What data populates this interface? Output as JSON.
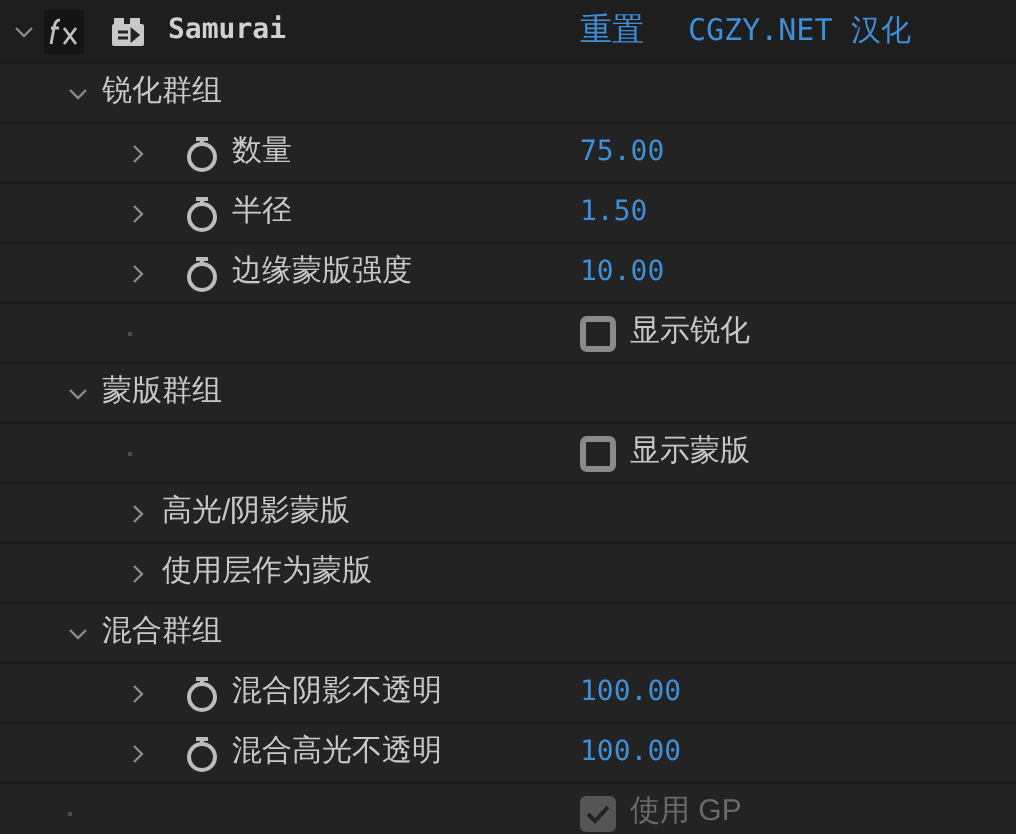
{
  "effect": {
    "name": "Samurai",
    "expanded": true,
    "reset": "重置",
    "credit": "CGZY.NET 汉化",
    "children": [
      {
        "kind": "group",
        "label": "锐化群组",
        "expanded": true,
        "children": [
          {
            "kind": "property",
            "label": "数量",
            "value": "75.00",
            "expanded": false
          },
          {
            "kind": "property",
            "label": "半径",
            "value": "1.50",
            "expanded": false
          },
          {
            "kind": "property",
            "label": "边缘蒙版强度",
            "value": "10.00",
            "expanded": false
          },
          {
            "kind": "checkbox",
            "label": "显示锐化",
            "checked": false,
            "disabled": false
          }
        ]
      },
      {
        "kind": "group",
        "label": "蒙版群组",
        "expanded": true,
        "children": [
          {
            "kind": "checkbox",
            "label": "显示蒙版",
            "checked": false,
            "disabled": false
          },
          {
            "kind": "group",
            "label": "高光/阴影蒙版",
            "expanded": false
          },
          {
            "kind": "group",
            "label": "使用层作为蒙版",
            "expanded": false
          }
        ]
      },
      {
        "kind": "group",
        "label": "混合群组",
        "expanded": true,
        "children": [
          {
            "kind": "property",
            "label": "混合阴影不透明",
            "value": "100.00",
            "expanded": false
          },
          {
            "kind": "property",
            "label": "混合高光不透明",
            "value": "100.00",
            "expanded": false
          }
        ]
      },
      {
        "kind": "checkbox",
        "label": "使用 GP",
        "checked": true,
        "disabled": true
      }
    ]
  }
}
